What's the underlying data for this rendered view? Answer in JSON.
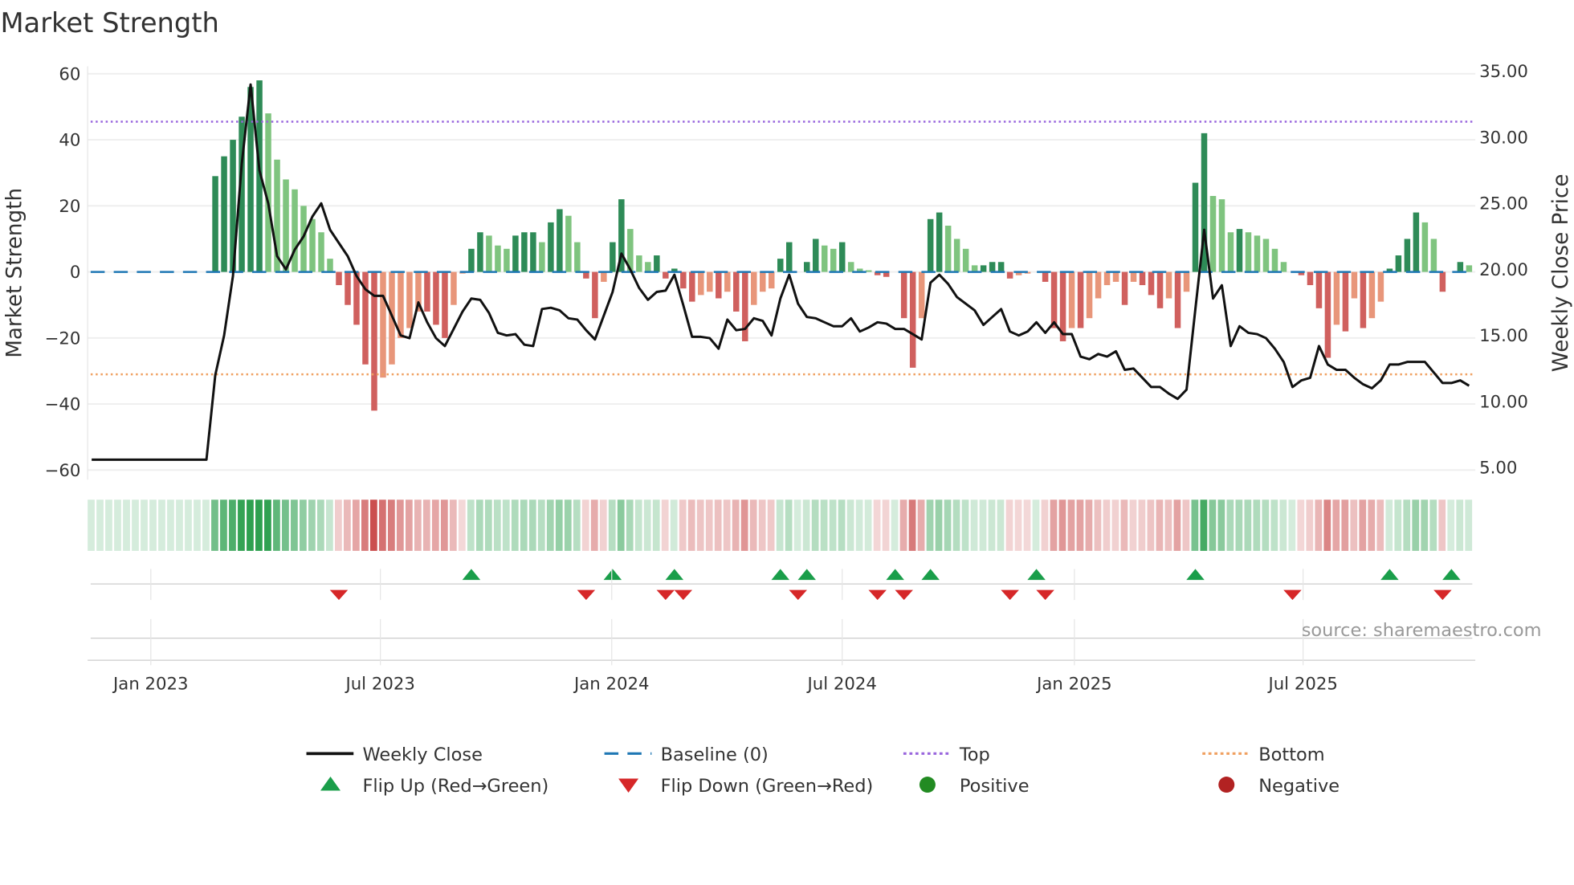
{
  "chart_data": {
    "type": "bar+line",
    "title": "Market Strength",
    "ylabel": "Market Strength",
    "y2label": "Weekly Close Price",
    "ylim": [
      -60,
      60
    ],
    "y2lim": [
      5,
      35
    ],
    "yticks": [
      "60",
      "40",
      "20",
      "0",
      "−20",
      "−40",
      "−60"
    ],
    "ytick_values": [
      60,
      40,
      20,
      0,
      -20,
      -40,
      -60
    ],
    "y2ticks": [
      "35.00",
      "30.00",
      "25.00",
      "20.00",
      "15.00",
      "10.00",
      "5.00"
    ],
    "y2tick_values": [
      35,
      30,
      25,
      20,
      15,
      10,
      5
    ],
    "xticks": [
      {
        "label": "Jan 2023",
        "week": 6.7
      },
      {
        "label": "Jul 2023",
        "week": 32.7
      },
      {
        "label": "Jan 2024",
        "week": 58.9
      },
      {
        "label": "Jul 2024",
        "week": 85
      },
      {
        "label": "Jan 2025",
        "week": 111.3
      },
      {
        "label": "Jul 2025",
        "week": 137.2
      }
    ],
    "top_level": 45.5,
    "bottom_level": -31,
    "baseline": 0,
    "strength": [
      0,
      0,
      0,
      0,
      0,
      0,
      0,
      0,
      0,
      0,
      0,
      0,
      0,
      0,
      29,
      35,
      40,
      47,
      56,
      58,
      48,
      34,
      28,
      25,
      20,
      16,
      12,
      4,
      -4,
      -10,
      -16,
      -28,
      -42,
      -32,
      -28,
      -20,
      -17,
      -12,
      -12,
      -16,
      -20,
      -10,
      -0.5,
      7,
      12,
      11,
      8,
      7,
      11,
      12,
      12,
      9,
      15,
      19,
      17,
      9,
      -2,
      -14,
      -3,
      9,
      22,
      13,
      5,
      3,
      5,
      -2,
      1,
      -5,
      -9,
      -7,
      -6,
      -8,
      -6,
      -12,
      -21,
      -10,
      -6,
      -5,
      4,
      9,
      0,
      3,
      10,
      8,
      7,
      9,
      3,
      1,
      0.5,
      -1,
      -1.5,
      0,
      -14,
      -29,
      -14,
      16,
      18,
      14,
      10,
      7,
      2,
      2,
      3,
      3,
      -2,
      -1,
      -0.5,
      0,
      -3,
      -17,
      -21,
      -17,
      -17,
      -14,
      -8,
      -4,
      -3,
      -10,
      -3,
      -4,
      -7,
      -11,
      -8,
      -17,
      -6,
      27,
      42,
      23,
      22,
      12,
      13,
      12,
      11,
      10,
      7,
      3,
      0,
      -1,
      -4,
      -11,
      -26,
      -16,
      -18,
      -8,
      -17,
      -14,
      -9,
      1,
      5,
      10,
      18,
      15,
      10,
      -6,
      0,
      3,
      2
    ],
    "weekly_close": [
      5.6,
      5.6,
      5.6,
      5.6,
      5.6,
      5.6,
      5.6,
      5.6,
      5.6,
      5.6,
      5.6,
      5.6,
      5.6,
      5.6,
      12,
      15,
      19.5,
      28,
      34,
      27.5,
      25,
      21,
      20,
      21.5,
      22.5,
      24,
      25,
      23,
      22,
      21,
      19.5,
      18.5,
      18,
      18,
      16.5,
      15,
      14.8,
      17.5,
      16,
      14.8,
      14.2,
      15.5,
      16.8,
      17.8,
      17.7,
      16.7,
      15.2,
      15,
      15.1,
      14.3,
      14.2,
      17,
      17.1,
      16.9,
      16.3,
      16.2,
      15.4,
      14.7,
      16.5,
      18.3,
      21.2,
      20,
      18.6,
      17.7,
      18.3,
      18.4,
      19.6,
      17.3,
      14.9,
      14.9,
      14.8,
      14,
      16.2,
      15.4,
      15.5,
      16.3,
      16.1,
      15,
      17.8,
      19.6,
      17.4,
      16.4,
      16.3,
      16,
      15.7,
      15.7,
      16.3,
      15.3,
      15.6,
      16,
      15.9,
      15.5,
      15.5,
      15.1,
      14.7,
      19,
      19.6,
      18.9,
      17.9,
      17.4,
      16.9,
      15.8,
      16.4,
      17,
      15.3,
      15,
      15.3,
      16,
      15.2,
      16,
      15.1,
      15.1,
      13.4,
      13.2,
      13.6,
      13.4,
      13.8,
      12.4,
      12.5,
      11.8,
      11.1,
      11.1,
      10.6,
      10.2,
      10.9,
      17,
      23,
      17.8,
      18.8,
      14.2,
      15.7,
      15.2,
      15.1,
      14.8,
      14,
      13,
      11.1,
      11.6,
      11.8,
      14.2,
      12.8,
      12.4,
      12.4,
      11.8,
      11.3,
      11,
      11.6,
      12.8,
      12.8,
      13,
      13,
      13,
      12.2,
      11.4,
      11.4,
      11.6,
      11.2
    ],
    "flip_up_weeks": [
      43,
      59,
      66,
      78,
      81,
      91,
      95,
      107,
      125,
      147,
      154
    ],
    "flip_down_weeks": [
      28,
      56,
      65,
      67,
      80,
      89,
      92,
      104,
      108,
      136,
      153
    ],
    "colors": {
      "pos_rising": "#2e8b57",
      "pos_falling": "#7fc47f",
      "neg_falling": "#d0605e",
      "neg_rising": "#e8967a",
      "line": "#111111",
      "baseline": "#1f77b4",
      "top": "#9966dd",
      "bottom": "#f0a060",
      "flip_up": "#1a9e4a",
      "flip_down": "#d62728",
      "positive": "#228b22",
      "negative": "#b22222"
    },
    "legend": {
      "placement": "bottom",
      "items": [
        {
          "label": "Weekly Close",
          "kind": "line"
        },
        {
          "label": "Baseline (0)",
          "kind": "dash"
        },
        {
          "label": "Top",
          "kind": "dot-top"
        },
        {
          "label": "Bottom",
          "kind": "dot-bottom"
        },
        {
          "label": "Flip Up (Red→Green)",
          "kind": "tri-up"
        },
        {
          "label": "Flip Down (Green→Red)",
          "kind": "tri-down"
        },
        {
          "label": "Positive",
          "kind": "circle-pos"
        },
        {
          "label": "Negative",
          "kind": "circle-neg"
        }
      ]
    },
    "source": "source: sharemaestro.com"
  }
}
